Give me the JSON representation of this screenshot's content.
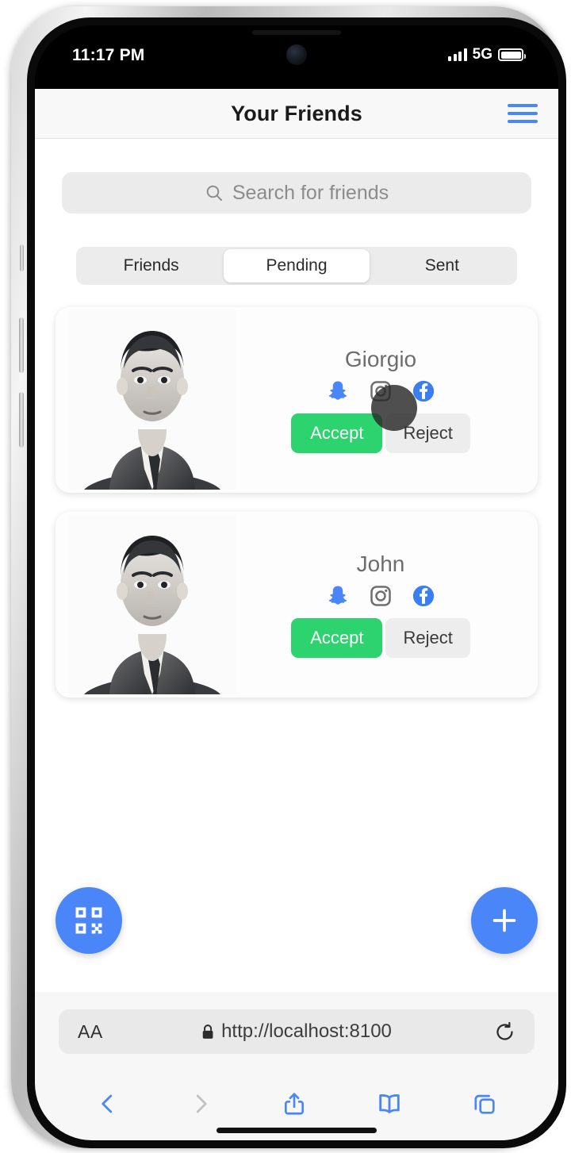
{
  "status_bar": {
    "time": "11:17 PM",
    "network": "5G",
    "signal_icon": "cellular-signal-icon",
    "battery_icon": "battery-full-icon"
  },
  "app": {
    "header": {
      "title": "Your Friends",
      "menu_icon": "hamburger-menu-icon"
    },
    "search": {
      "placeholder": "Search for friends",
      "icon": "search-icon"
    },
    "tabs": [
      {
        "label": "Friends",
        "active": false
      },
      {
        "label": "Pending",
        "active": true
      },
      {
        "label": "Sent",
        "active": false
      }
    ],
    "friend_requests": [
      {
        "name": "Giorgio",
        "avatar_alt": "portrait-photo",
        "socials": [
          "snapchat-icon",
          "instagram-icon",
          "facebook-icon"
        ],
        "accept_label": "Accept",
        "reject_label": "Reject"
      },
      {
        "name": "John",
        "avatar_alt": "portrait-photo",
        "socials": [
          "snapchat-icon",
          "instagram-icon",
          "facebook-icon"
        ],
        "accept_label": "Accept",
        "reject_label": "Reject"
      }
    ],
    "fab": {
      "qr_icon": "qr-code-icon",
      "add_icon": "plus-icon"
    }
  },
  "browser": {
    "text_size_label": "AA",
    "lock_icon": "lock-icon",
    "url": "http://localhost:8100",
    "reload_icon": "reload-icon",
    "toolbar": [
      {
        "icon": "back-arrow-icon",
        "enabled": true
      },
      {
        "icon": "forward-arrow-icon",
        "enabled": false
      },
      {
        "icon": "share-icon",
        "enabled": true
      },
      {
        "icon": "bookmarks-icon",
        "enabled": true
      },
      {
        "icon": "tabs-icon",
        "enabled": true
      }
    ]
  },
  "colors": {
    "accent_blue": "#4a86f7",
    "accept_green": "#2dd36f",
    "facebook_blue": "#3a7ef0",
    "snapchat_blue": "#4a86f7"
  }
}
